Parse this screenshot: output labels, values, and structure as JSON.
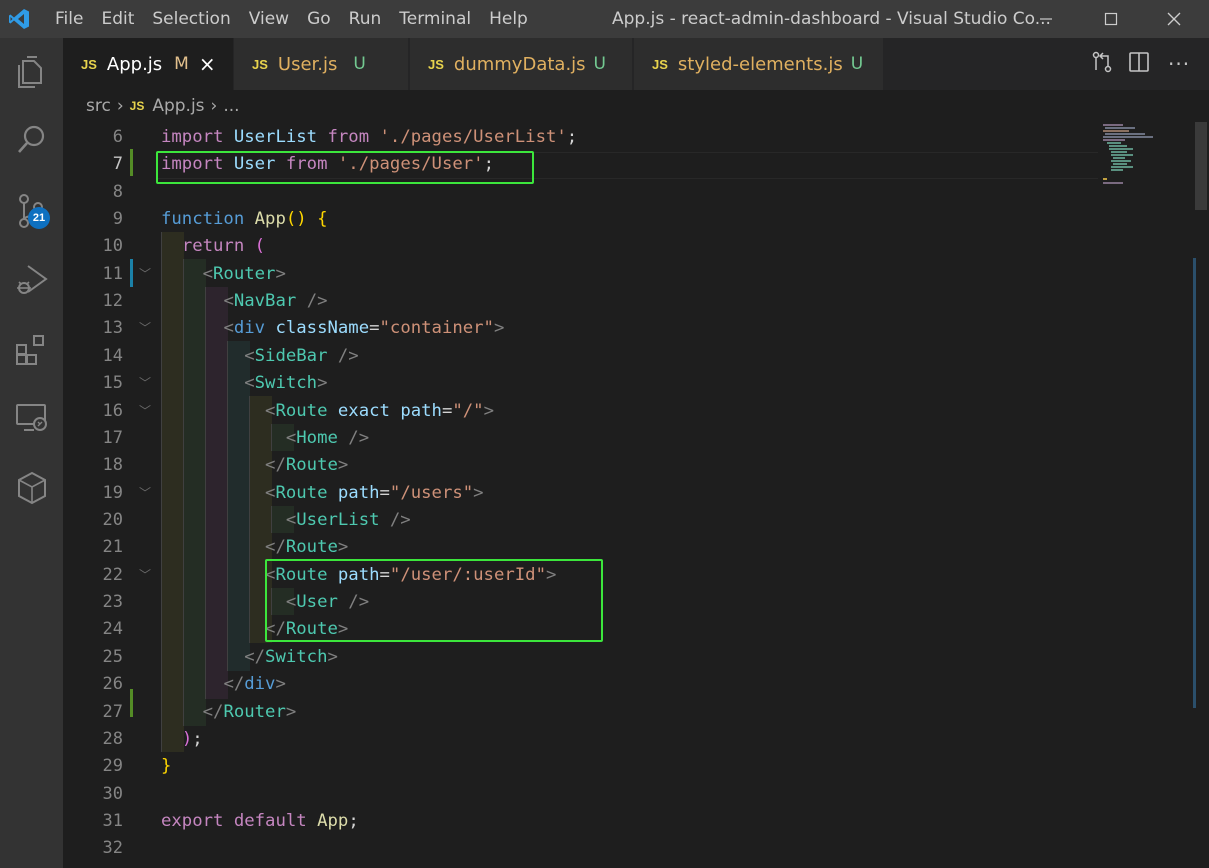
{
  "menu": {
    "items": [
      "File",
      "Edit",
      "Selection",
      "View",
      "Go",
      "Run",
      "Terminal",
      "Help"
    ]
  },
  "window": {
    "title": "App.js - react-admin-dashboard - Visual Studio Co..."
  },
  "activity": {
    "icons": [
      "explorer-icon",
      "search-icon",
      "source-control-icon",
      "run-debug-icon",
      "extensions-icon",
      "remote-explorer-icon",
      "docker-icon"
    ],
    "source_control_badge": "21"
  },
  "tabs": [
    {
      "icon": "JS",
      "name": "App.js",
      "flag": "M",
      "active": true
    },
    {
      "icon": "JS",
      "name": "User.js",
      "flag": "U",
      "active": false
    },
    {
      "icon": "JS",
      "name": "dummyData.js",
      "flag": "U",
      "active": false
    },
    {
      "icon": "JS",
      "name": "styled-elements.js",
      "flag": "U",
      "active": false
    }
  ],
  "breadcrumb": {
    "folder": "src",
    "icon": "JS",
    "file": "App.js",
    "more": "..."
  },
  "editor": {
    "current_line": 7,
    "line_numbers": [
      "6",
      "7",
      "8",
      "9",
      "10",
      "11",
      "12",
      "13",
      "14",
      "15",
      "16",
      "17",
      "18",
      "19",
      "20",
      "21",
      "22",
      "23",
      "24",
      "25",
      "26",
      "27",
      "28",
      "29",
      "30",
      "31",
      "32"
    ],
    "lines": [
      "import UserList from './pages/UserList';",
      "import User from './pages/User';",
      "",
      "function App() {",
      "  return (",
      "    <Router>",
      "      <NavBar />",
      "      <div className=\"container\">",
      "        <SideBar />",
      "        <Switch>",
      "          <Route exact path=\"/\">",
      "            <Home />",
      "          </Route>",
      "          <Route path=\"/users\">",
      "            <UserList />",
      "          </Route>",
      "          <Route path=\"/user/:userId\">",
      "            <User />",
      "          </Route>",
      "        </Switch>",
      "      </div>",
      "    </Router>",
      "  );",
      "}",
      "",
      "export default App;",
      ""
    ]
  },
  "colors": {
    "highlight_box": "#3ce63c",
    "editor_bg": "#1e1e1e",
    "titlebar_bg": "#3c3c3c",
    "activitybar_bg": "#333333",
    "badge": "#0e70c0"
  }
}
